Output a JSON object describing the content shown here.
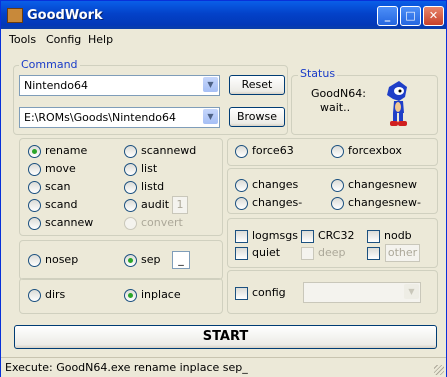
{
  "window": {
    "title": "GoodWork"
  },
  "menu": [
    "Tools",
    "Config",
    "Help"
  ],
  "command": {
    "label": "Command",
    "system": "Nintendo64",
    "path": "E:\\ROMs\\Goods\\Nintendo64",
    "reset_label": "Reset",
    "browse_label": "Browse"
  },
  "status": {
    "label": "Status",
    "line1": "GoodN64:",
    "line2": "wait.."
  },
  "modes": {
    "rename": "rename",
    "move": "move",
    "scan": "scan",
    "scand": "scand",
    "scannew": "scannew",
    "scannewd": "scannewd",
    "list": "list",
    "listd": "listd",
    "audit": "audit",
    "audit_value": "1",
    "convert": "convert",
    "selected": "rename"
  },
  "force": {
    "force63": "force63",
    "forcexbox": "forcexbox"
  },
  "changes": {
    "changes": "changes",
    "changesnew": "changesnew",
    "changes_minus": "changes-",
    "changesnew_minus": "changesnew-"
  },
  "sep": {
    "nosep": "nosep",
    "sep": "sep",
    "sep_char": "_",
    "selected": "sep"
  },
  "dirs": {
    "dirs": "dirs",
    "inplace": "inplace",
    "selected": "inplace"
  },
  "options": {
    "logmsgs": "logmsgs",
    "crc32": "CRC32",
    "nodb": "nodb",
    "quiet": "quiet",
    "deep": "deep",
    "other": "other"
  },
  "config": {
    "label": "config"
  },
  "start_label": "START",
  "statusbar": {
    "text": "Execute:  GoodN64.exe rename inplace sep_"
  },
  "colors": {
    "titlebar": "#0342c9",
    "accent": "#1a3cc8",
    "radio_on": "#2aa52a"
  }
}
